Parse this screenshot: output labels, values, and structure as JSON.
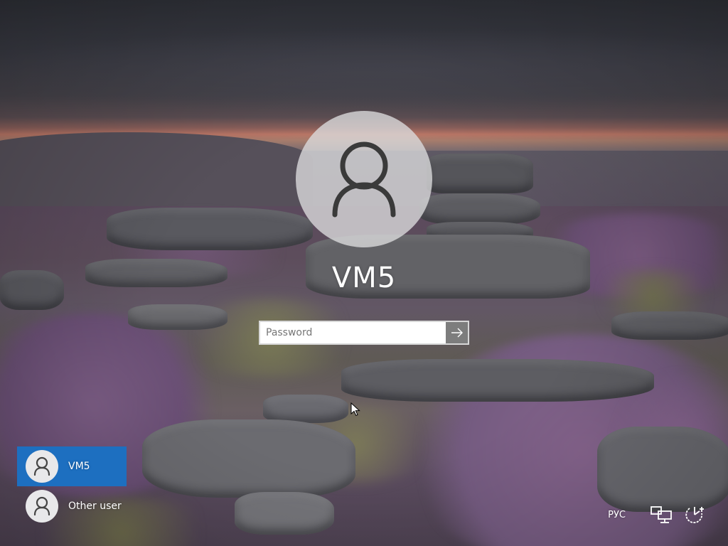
{
  "login": {
    "username": "VM5",
    "password_placeholder": "Password",
    "password_value": "",
    "submit_icon": "arrow-right-icon"
  },
  "user_list": {
    "users": [
      {
        "label": "VM5",
        "selected": true,
        "icon": "user-avatar-icon"
      },
      {
        "label": "Other user",
        "selected": false,
        "icon": "user-avatar-icon"
      }
    ]
  },
  "tray": {
    "language": "РУС",
    "network_icon": "network-icon",
    "accessibility_icon": "ease-of-access-icon",
    "power_icon": "power-icon"
  },
  "colors": {
    "selected_user_bg": "#1d6fc0",
    "submit_button_bg": "#7d7d7d",
    "text": "#ffffff"
  }
}
